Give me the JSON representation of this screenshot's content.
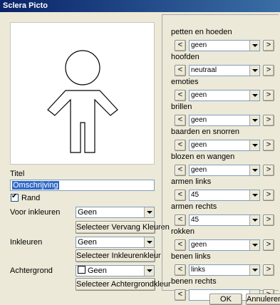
{
  "window": {
    "title": "Sclera Picto"
  },
  "canvas": {
    "icon": "person-outline-icon"
  },
  "left": {
    "title_label": "Titel",
    "title_input_value": "Omschrijving",
    "rand_label": "Rand",
    "rand_checked": true,
    "voor_inkleuren_label": "Voor inkleuren",
    "voor_inkleuren_value": "Geen",
    "vervang_button": "Selecteer Vervang Kleuren",
    "inkleuren_label": "Inkleuren",
    "inkleuren_value": "Geen",
    "inkleuren_button": "Selecteer Inkleurenkleur",
    "achtergrond_label": "Achtergrond",
    "achtergrond_value": "Geen",
    "achtergrond_button": "Selecteer Achtergrondkleur"
  },
  "right": {
    "prev_label": "<",
    "next_label": ">",
    "categories": [
      {
        "label": "petten en hoeden",
        "value": "geen"
      },
      {
        "label": "hoofden",
        "value": "neutraal"
      },
      {
        "label": "emoties",
        "value": "geen"
      },
      {
        "label": "brillen",
        "value": "geen"
      },
      {
        "label": "baarden en snorren",
        "value": "geen"
      },
      {
        "label": "blozen en wangen",
        "value": "geen"
      },
      {
        "label": "armen links",
        "value": "45"
      },
      {
        "label": "armen rechts",
        "value": "45"
      },
      {
        "label": "rokken",
        "value": "geen"
      },
      {
        "label": "benen links",
        "value": "links"
      },
      {
        "label": "benen rechts",
        "value": ""
      }
    ]
  },
  "footer": {
    "ok_label": "OK",
    "cancel_label": "Annuleren"
  }
}
